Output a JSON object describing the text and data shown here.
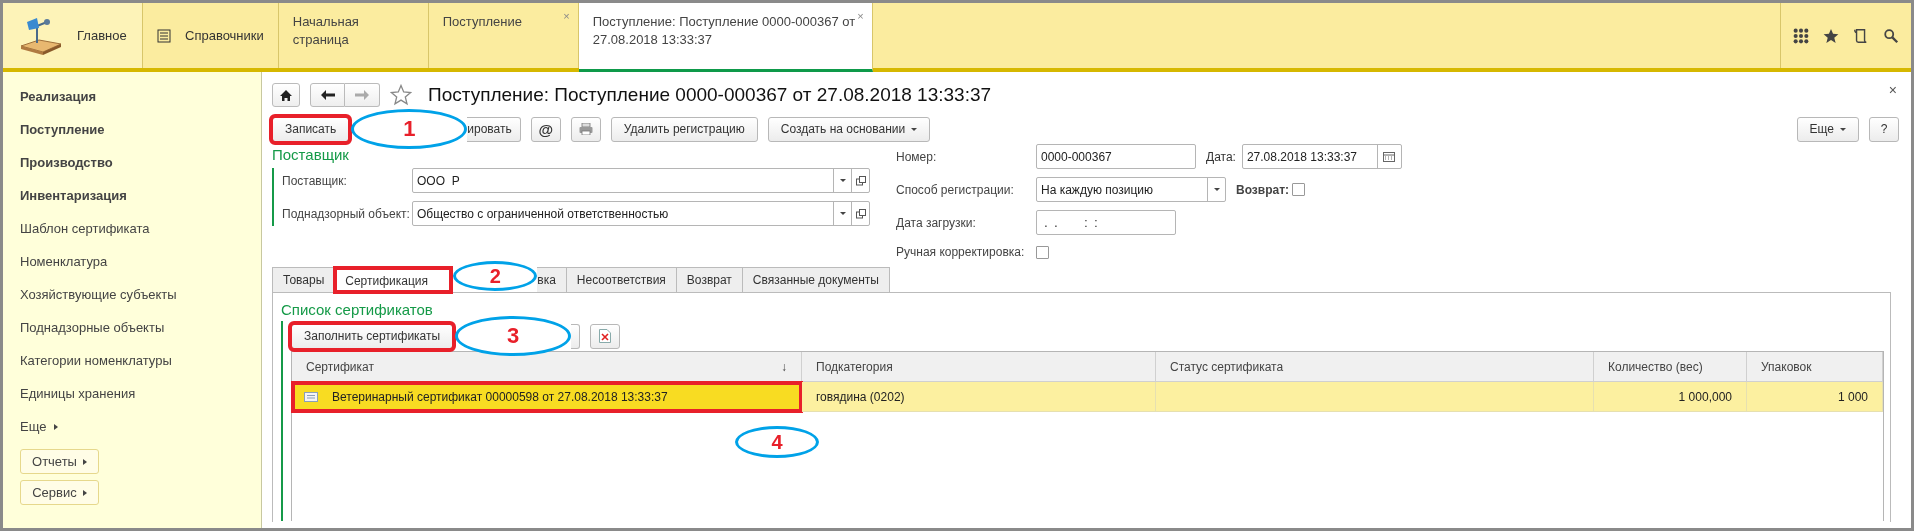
{
  "top_bar": {
    "sections": [
      {
        "label": "Главное",
        "kind": "desk",
        "selected": true
      },
      {
        "label": "Справочники",
        "kind": "list",
        "selected": false
      }
    ],
    "tabs": [
      {
        "label": "Начальная страница",
        "selected": false
      },
      {
        "label": "Поступление",
        "selected": false,
        "close": "×"
      },
      {
        "label": "Поступление: Поступление 0000-000367 от 27.08.2018 13:33:37",
        "selected": true,
        "close": "×"
      }
    ],
    "tools": [
      {
        "kind": "apps"
      },
      {
        "kind": "star"
      },
      {
        "kind": "history"
      },
      {
        "kind": "search"
      }
    ]
  },
  "sidebar": {
    "items": [
      {
        "label": "Реализация",
        "bold": true
      },
      {
        "label": "Поступление",
        "bold": true
      },
      {
        "label": "Производство",
        "bold": true
      },
      {
        "label": "Инвентаризация",
        "bold": true
      },
      {
        "label": "Шаблон сертификата",
        "bold": false
      },
      {
        "label": "Номенклатура",
        "bold": false
      },
      {
        "label": "Хозяйствующие субъекты",
        "bold": false
      },
      {
        "label": "Поднадзорные объекты",
        "bold": false
      },
      {
        "label": "Категории номенклатуры",
        "bold": false
      },
      {
        "label": "Единицы хранения",
        "bold": false
      },
      {
        "label": "Еще",
        "bold": false,
        "menu": true
      }
    ],
    "buttons": [
      "Отчеты",
      "Сервис"
    ]
  },
  "form": {
    "title": "Поступление: Поступление 0000-000367 от 27.08.2018 13:33:37",
    "close": "×",
    "toolbar": [
      {
        "kind": "text",
        "label": "Записать",
        "highlight": true,
        "callout": "1"
      },
      {
        "kind": "partial",
        "label": "ировать",
        "highlight": false
      },
      {
        "kind": "text",
        "label": "@",
        "highlight": false
      },
      {
        "kind": "print",
        "highlight": false
      },
      {
        "kind": "text",
        "label": "Удалить регистрацию",
        "highlight": false
      },
      {
        "kind": "text",
        "label": "Создать на основании",
        "highlight": false,
        "menu": true
      }
    ],
    "toolbar_right": [
      {
        "label": "Еще",
        "menu": true
      },
      {
        "label": "?",
        "menu": false
      }
    ],
    "supplier_group": {
      "title": "Поставщик",
      "fields": [
        {
          "label": "Поставщик:",
          "value": "ООО  Р"
        },
        {
          "label": "Поднадзорный объект:",
          "value": "Общество с ограниченной ответственностью"
        }
      ]
    },
    "number": {
      "label": "Номер:",
      "value": "0000-000367"
    },
    "date": {
      "label": "Дата:",
      "value": "27.08.2018 13:33:37"
    },
    "registration_method": {
      "label": "Способ регистрации:",
      "value": "На каждую позицию"
    },
    "return": {
      "label": "Возврат:",
      "checked": false
    },
    "load_date": {
      "label": "Дата загрузки:",
      "value": " .  .        :  :"
    },
    "manual_correction": {
      "label": "Ручная корректировка:",
      "checked": false
    },
    "tabs": [
      {
        "label": "Товары",
        "selected": false,
        "highlight": false
      },
      {
        "label": "Сертификация",
        "selected": true,
        "highlight": true,
        "callout": "2"
      },
      {
        "label": "вка",
        "selected": false,
        "highlight": false,
        "partial": true
      },
      {
        "label": "Несоответствия",
        "selected": false,
        "highlight": false
      },
      {
        "label": "Возврат",
        "selected": false,
        "highlight": false
      },
      {
        "label": "Связанные документы",
        "selected": false,
        "highlight": false
      }
    ],
    "certificates": {
      "title": "Список сертификатов",
      "toolbar": [
        {
          "kind": "text",
          "label": "Заполнить сертификаты",
          "highlight": true,
          "callout": "3"
        },
        {
          "kind": "partial",
          "highlight": false
        },
        {
          "kind": "delete",
          "highlight": false
        }
      ],
      "columns": [
        {
          "label": "Сертификат",
          "sort_mark": "↓"
        },
        {
          "label": "Подкатегория"
        },
        {
          "label": "Статус сертификата"
        },
        {
          "label": "Количество (вес)",
          "numeric": true
        },
        {
          "label": "Упаковок",
          "numeric": true
        }
      ],
      "rows": [
        {
          "cells": [
            "Ветеринарный сертификат 00000598 от 27.08.2018 13:33:37",
            "говядина (0202)",
            "",
            "1 000,000",
            "1 000"
          ],
          "selected": true,
          "highlight": true,
          "callout": "4"
        }
      ]
    }
  }
}
